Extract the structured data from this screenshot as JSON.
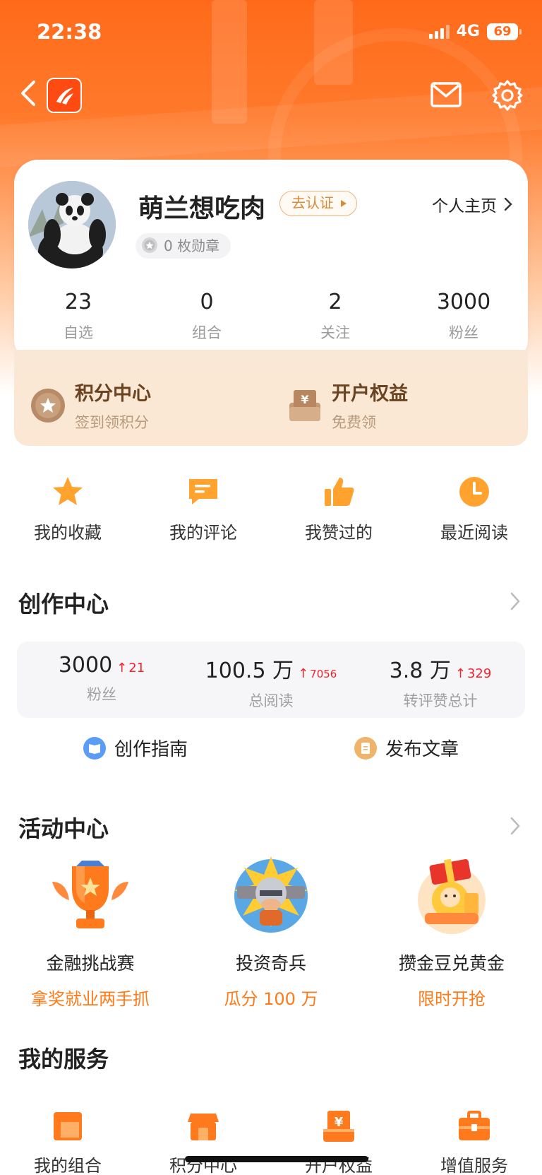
{
  "status_bar": {
    "time": "22:38",
    "network": "4G",
    "battery": "69"
  },
  "profile": {
    "username": "萌兰想吃肉",
    "verify_label": "去认证",
    "homepage_label": "个人主页",
    "medals": "0 枚勋章",
    "stats": [
      {
        "value": "23",
        "label": "自选"
      },
      {
        "value": "0",
        "label": "组合"
      },
      {
        "value": "2",
        "label": "关注"
      },
      {
        "value": "3000",
        "label": "粉丝"
      }
    ]
  },
  "benefits": [
    {
      "title": "积分中心",
      "subtitle": "签到领积分",
      "icon": "star-badge-icon"
    },
    {
      "title": "开户权益",
      "subtitle": "免费领",
      "icon": "yuan-box-icon"
    }
  ],
  "quick_actions": [
    {
      "label": "我的收藏",
      "icon": "star-icon"
    },
    {
      "label": "我的评论",
      "icon": "comment-icon"
    },
    {
      "label": "我赞过的",
      "icon": "thumbs-up-icon"
    },
    {
      "label": "最近阅读",
      "icon": "clock-icon"
    }
  ],
  "creation": {
    "title": "创作中心",
    "stats": [
      {
        "value": "3000",
        "delta": "21",
        "label": "粉丝"
      },
      {
        "value": "100.5 万",
        "delta": "7056",
        "label": "总阅读"
      },
      {
        "value": "3.8 万",
        "delta": "329",
        "label": "转评赞总计"
      }
    ],
    "actions": [
      {
        "label": "创作指南",
        "icon": "book-icon",
        "color": "#5b9cf5"
      },
      {
        "label": "发布文章",
        "icon": "document-icon",
        "color": "#f0b36a"
      }
    ]
  },
  "activities": {
    "title": "活动中心",
    "items": [
      {
        "title": "金融挑战赛",
        "subtitle": "拿奖就业两手抓",
        "icon": "trophy-icon"
      },
      {
        "title": "投资奇兵",
        "subtitle": "瓜分 100 万",
        "icon": "soldier-icon"
      },
      {
        "title": "攒金豆兑黄金",
        "subtitle": "限时开抢",
        "icon": "gift-box-icon"
      }
    ]
  },
  "services": {
    "title": "我的服务",
    "items": [
      {
        "label": "我的组合",
        "icon": "portfolio-icon"
      },
      {
        "label": "积分中心",
        "icon": "store-icon"
      },
      {
        "label": "开户权益",
        "icon": "account-icon"
      },
      {
        "label": "增值服务",
        "icon": "briefcase-icon"
      }
    ]
  },
  "colors": {
    "brand": "#ff6a1a",
    "accent": "#ff8a1e",
    "up": "#f5222d"
  }
}
